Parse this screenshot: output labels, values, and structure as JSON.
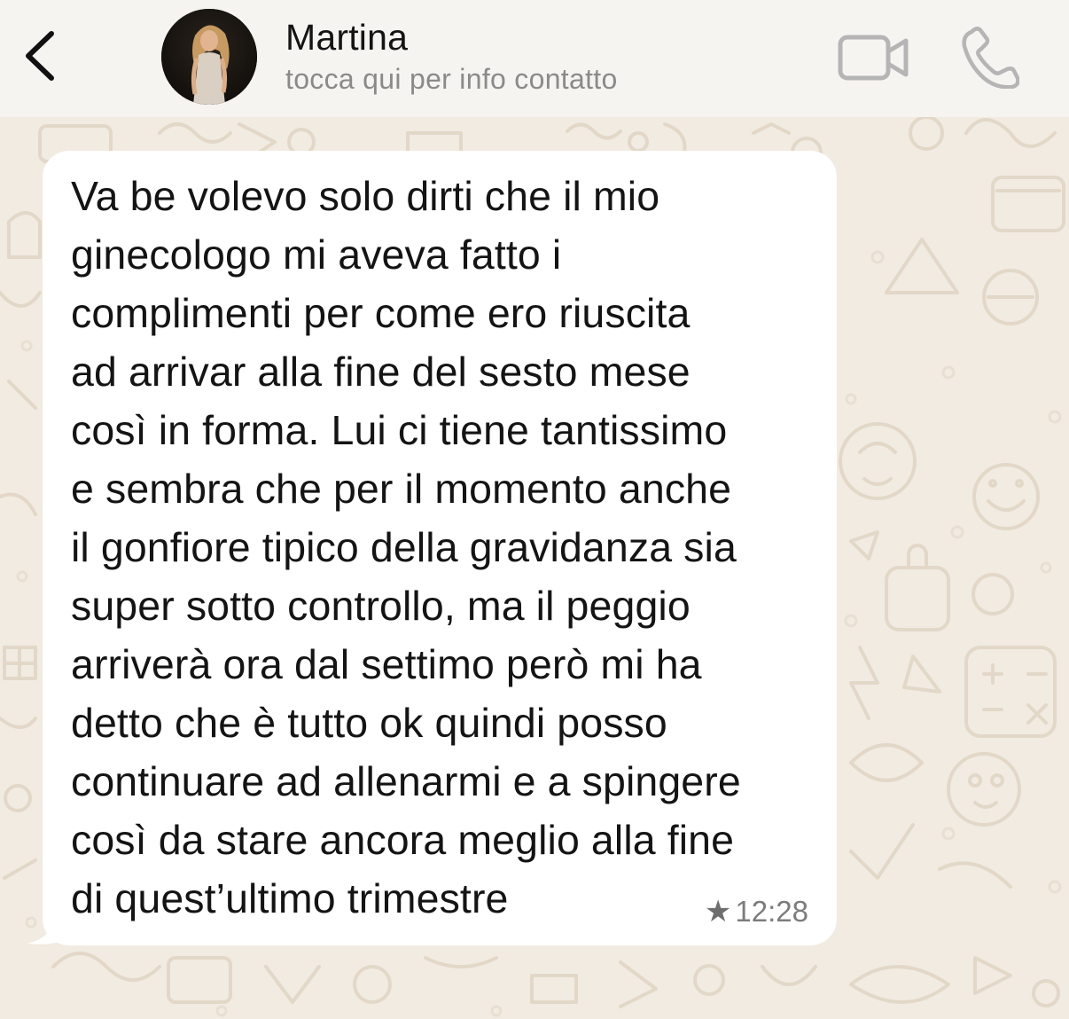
{
  "header": {
    "contact_name": "Martina",
    "contact_subtitle": "tocca qui per info contatto",
    "icons": {
      "back": "chevron-left-icon",
      "video": "video-camera-icon",
      "call": "phone-icon"
    }
  },
  "chat": {
    "messages": [
      {
        "text": "Va be volevo solo dirti che il mio\nginecologo mi aveva fatto i\ncomplimenti per come ero riuscita\nad arrivar alla fine del sesto mese\ncosì in forma. Lui ci tiene tantissimo\ne sembra che per il momento anche\nil gonfiore tipico della gravidanza sia\nsuper sotto controllo, ma il peggio\narriverà ora dal settimo però mi ha\ndetto che è tutto ok quindi posso\ncontinuare ad allenarmi e a spingere\ncosì da stare ancora meglio alla fine\ndi quest’ultimo trimestre",
        "starred_glyph": "★",
        "time": "12:28",
        "direction": "incoming"
      }
    ]
  },
  "colors": {
    "wallpaper": "#f1ebe2",
    "wallpaper_doodle": "#e6dccd",
    "header_bg": "#f6f4f0",
    "bubble_bg": "#ffffff",
    "icon_gray": "#b5b5b5"
  }
}
